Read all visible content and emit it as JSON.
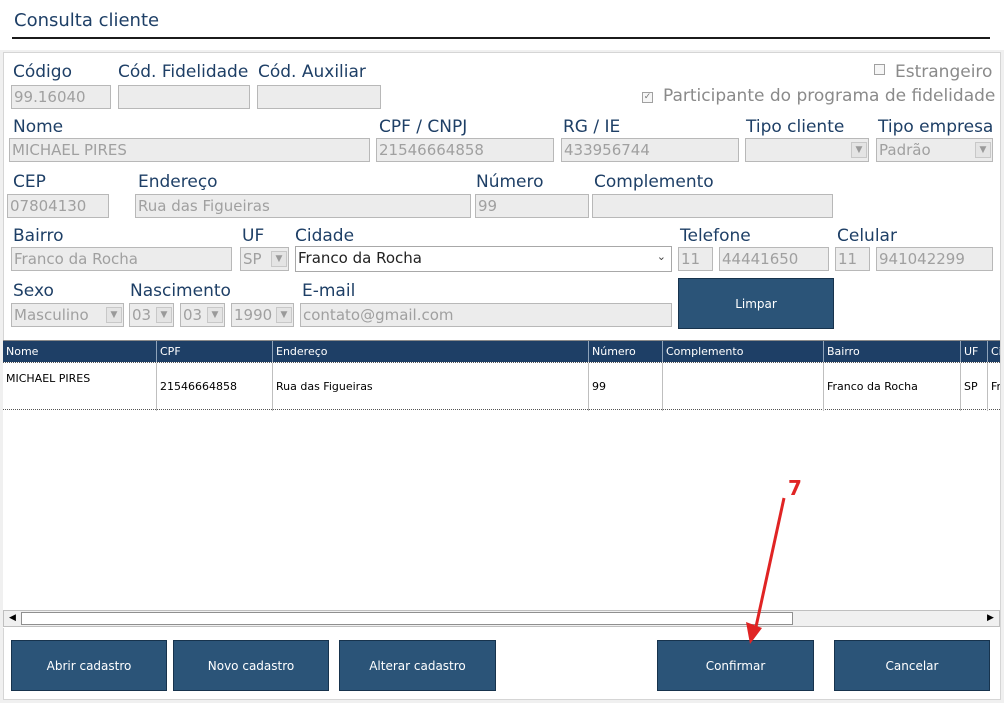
{
  "window": {
    "title": "Consulta cliente"
  },
  "form": {
    "codigo": {
      "label": "Código",
      "value": "99.16040"
    },
    "cod_fidelidade": {
      "label": "Cód. Fidelidade",
      "value": ""
    },
    "cod_auxiliar": {
      "label": "Cód. Auxiliar",
      "value": ""
    },
    "estrangeiro": {
      "label": "Estrangeiro",
      "checked": false
    },
    "participante": {
      "label": "Participante do programa de fidelidade",
      "checked": true
    },
    "nome": {
      "label": "Nome",
      "value": "MICHAEL PIRES"
    },
    "cpf_cnpj": {
      "label": "CPF / CNPJ",
      "value": "21546664858"
    },
    "rg_ie": {
      "label": "RG / IE",
      "value": "433956744"
    },
    "tipo_cliente": {
      "label": "Tipo cliente",
      "value": ""
    },
    "tipo_empresa": {
      "label": "Tipo empresa",
      "value": "Padrão"
    },
    "cep": {
      "label": "CEP",
      "value": "07804130"
    },
    "endereco": {
      "label": "Endereço",
      "value": "Rua das Figueiras"
    },
    "numero": {
      "label": "Número",
      "value": "99"
    },
    "complemento": {
      "label": "Complemento",
      "value": ""
    },
    "bairro": {
      "label": "Bairro",
      "value": "Franco da Rocha"
    },
    "uf": {
      "label": "UF",
      "value": "SP"
    },
    "cidade": {
      "label": "Cidade",
      "value": "Franco da Rocha"
    },
    "telefone": {
      "label": "Telefone",
      "ddd": "11",
      "value": "44441650"
    },
    "celular": {
      "label": "Celular",
      "ddd": "11",
      "value": "941042299"
    },
    "sexo": {
      "label": "Sexo",
      "value": "Masculino"
    },
    "nascimento": {
      "label": "Nascimento",
      "day": "03",
      "month": "03",
      "year": "1990"
    },
    "email": {
      "label": "E-mail",
      "value": "contato@gmail.com"
    },
    "limpar_label": "Limpar"
  },
  "grid": {
    "columns": [
      "Nome",
      "CPF",
      "Endereço",
      "Número",
      "Complemento",
      "Bairro",
      "UF",
      "Ci"
    ],
    "rows": [
      [
        "MICHAEL PIRES",
        "21546664858",
        "Rua das Figueiras",
        "99",
        "",
        "Franco da Rocha",
        "SP",
        "Fr"
      ]
    ]
  },
  "footer": {
    "abrir_cadastro": "Abrir cadastro",
    "novo_cadastro": "Novo cadastro",
    "alterar_cadastro": "Alterar cadastro",
    "confirmar": "Confirmar",
    "cancelar": "Cancelar"
  },
  "annotation": {
    "step_number": "7",
    "color": "#e02424"
  },
  "colors": {
    "accent": "#2b5478",
    "header": "#1e3f66"
  }
}
